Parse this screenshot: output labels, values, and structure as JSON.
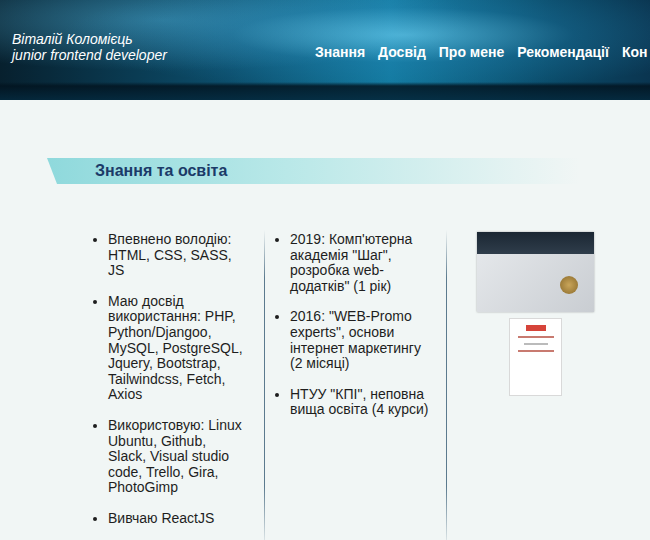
{
  "header": {
    "name": "Віталій Коломієць",
    "role": "junior frontend developer"
  },
  "nav": [
    {
      "label": "Знання"
    },
    {
      "label": "Досвід"
    },
    {
      "label": "Про мене"
    },
    {
      "label": "Рекомендації"
    },
    {
      "label": "Кон"
    }
  ],
  "section": {
    "title": "Знання та освіта"
  },
  "skills": [
    "Впевнено володію: HTML, CSS, SASS, JS",
    "Маю досвід використання: PHP, Python/Djangoo, MySQL, PostgreSQL, Jquery, Bootstrap, Tailwindcss, Fetch, Axios",
    "Використовую: Linux Ubuntu, Github, Slack, Visual studio code, Trello, Gira, PhotoGimp",
    "Вивчаю ReactJS"
  ],
  "education": [
    "2019: Комп'ютерна академія \"Шаг\", розробка web-додатків\" (1 рік)",
    "2016: \"WEB-Promo experts\", основи інтернет маркетингу (2 місяці)",
    "НТУУ \"КПІ\", неповна вища освіта (4 курси)"
  ],
  "certificates": [
    {
      "kind": "diploma"
    },
    {
      "kind": "certificate"
    }
  ]
}
